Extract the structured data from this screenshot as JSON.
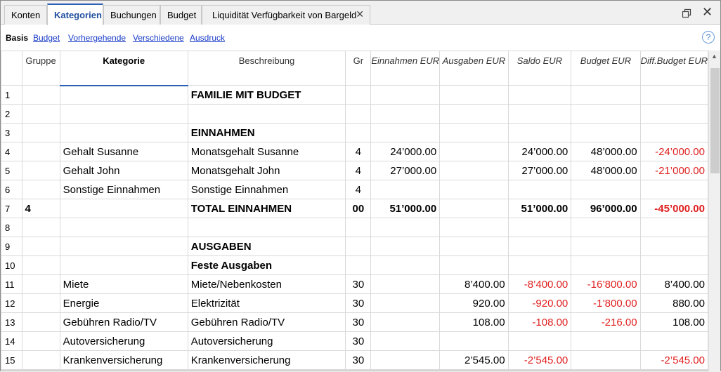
{
  "tabs": [
    {
      "label": "Konten"
    },
    {
      "label": "Kategorien"
    },
    {
      "label": "Buchungen"
    },
    {
      "label": "Budget"
    },
    {
      "label": "Liquidität Verfügbarkeit von Bargeld"
    }
  ],
  "active_tab": "Kategorien",
  "views": [
    "Basis",
    "Budget",
    "Vorhergehende",
    "Verschiedene",
    "Ausdruck"
  ],
  "icons": {
    "tab_close": "close-icon",
    "restore": "window-restore-icon",
    "close": "window-close-icon",
    "help": "help-icon"
  },
  "colors": {
    "negative": "#e02020",
    "link": "#1a3cc7",
    "accent": "#2d5fb4"
  },
  "columns": {
    "gruppe": "Gruppe",
    "kategorie": "Kategorie",
    "beschreibung": "Beschreibung",
    "gr": "Gr",
    "einnahmen": "Einnahmen EUR",
    "ausgaben": "Ausgaben EUR",
    "saldo": "Saldo EUR",
    "budget": "Budget EUR",
    "diff": "Diff.Budget EUR"
  },
  "rows": [
    {
      "n": "1",
      "gruppe": "",
      "kategorie": "",
      "beschreibung": "FAMILIE MIT BUDGET",
      "gr": "",
      "einnahmen": "",
      "ausgaben": "",
      "saldo": "",
      "budget": "",
      "diff": "",
      "bold": true
    },
    {
      "n": "2",
      "gruppe": "",
      "kategorie": "",
      "beschreibung": "",
      "gr": "",
      "einnahmen": "",
      "ausgaben": "",
      "saldo": "",
      "budget": "",
      "diff": ""
    },
    {
      "n": "3",
      "gruppe": "",
      "kategorie": "",
      "beschreibung": "EINNAHMEN",
      "gr": "",
      "einnahmen": "",
      "ausgaben": "",
      "saldo": "",
      "budget": "",
      "diff": "",
      "bold": true
    },
    {
      "n": "4",
      "gruppe": "",
      "kategorie": "Gehalt Susanne",
      "beschreibung": "Monatsgehalt Susanne",
      "gr": "4",
      "einnahmen": "24’000.00",
      "ausgaben": "",
      "saldo": "24’000.00",
      "budget": "48’000.00",
      "diff": "-24’000.00"
    },
    {
      "n": "5",
      "gruppe": "",
      "kategorie": "Gehalt John",
      "beschreibung": "Monatsgehalt John",
      "gr": "4",
      "einnahmen": "27’000.00",
      "ausgaben": "",
      "saldo": "27’000.00",
      "budget": "48’000.00",
      "diff": "-21’000.00"
    },
    {
      "n": "6",
      "gruppe": "",
      "kategorie": "Sonstige Einnahmen",
      "beschreibung": "Sonstige Einnahmen",
      "gr": "4",
      "einnahmen": "",
      "ausgaben": "",
      "saldo": "",
      "budget": "",
      "diff": ""
    },
    {
      "n": "7",
      "gruppe": "4",
      "kategorie": "",
      "beschreibung": "TOTAL EINNAHMEN",
      "gr": "00",
      "einnahmen": "51’000.00",
      "ausgaben": "",
      "saldo": "51’000.00",
      "budget": "96’000.00",
      "diff": "-45’000.00",
      "bold": true
    },
    {
      "n": "8",
      "gruppe": "",
      "kategorie": "",
      "beschreibung": "",
      "gr": "",
      "einnahmen": "",
      "ausgaben": "",
      "saldo": "",
      "budget": "",
      "diff": ""
    },
    {
      "n": "9",
      "gruppe": "",
      "kategorie": "",
      "beschreibung": "AUSGABEN",
      "gr": "",
      "einnahmen": "",
      "ausgaben": "",
      "saldo": "",
      "budget": "",
      "diff": "",
      "bold": true
    },
    {
      "n": "10",
      "gruppe": "",
      "kategorie": "",
      "beschreibung": "Feste Ausgaben",
      "gr": "",
      "einnahmen": "",
      "ausgaben": "",
      "saldo": "",
      "budget": "",
      "diff": "",
      "bold": true
    },
    {
      "n": "11",
      "gruppe": "",
      "kategorie": "Miete",
      "beschreibung": "Miete/Nebenkosten",
      "gr": "30",
      "einnahmen": "",
      "ausgaben": "8’400.00",
      "saldo": "-8’400.00",
      "budget": "-16’800.00",
      "diff": "8’400.00"
    },
    {
      "n": "12",
      "gruppe": "",
      "kategorie": "Energie",
      "beschreibung": "Elektrizität",
      "gr": "30",
      "einnahmen": "",
      "ausgaben": "920.00",
      "saldo": "-920.00",
      "budget": "-1’800.00",
      "diff": "880.00"
    },
    {
      "n": "13",
      "gruppe": "",
      "kategorie": "Gebühren Radio/TV",
      "beschreibung": "Gebühren Radio/TV",
      "gr": "30",
      "einnahmen": "",
      "ausgaben": "108.00",
      "saldo": "-108.00",
      "budget": "-216.00",
      "diff": "108.00"
    },
    {
      "n": "14",
      "gruppe": "",
      "kategorie": "Autoversicherung",
      "beschreibung": "Autoversicherung",
      "gr": "30",
      "einnahmen": "",
      "ausgaben": "",
      "saldo": "",
      "budget": "",
      "diff": ""
    },
    {
      "n": "15",
      "gruppe": "",
      "kategorie": "Krankenversicherung",
      "beschreibung": "Krankenversicherung",
      "gr": "30",
      "einnahmen": "",
      "ausgaben": "2’545.00",
      "saldo": "-2’545.00",
      "budget": "",
      "diff": "-2’545.00"
    }
  ]
}
